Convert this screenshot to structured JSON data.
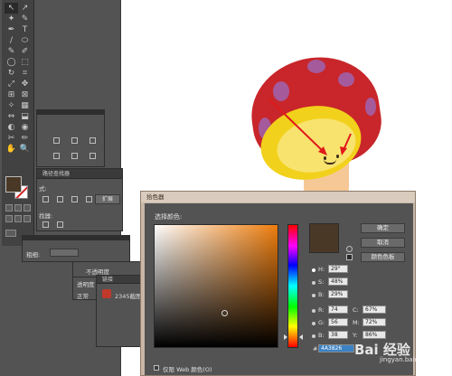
{
  "toolbar": {
    "tools": [
      "↖",
      "↗",
      "✦",
      "✎",
      "✒",
      "T",
      "/",
      "⬭",
      "✎",
      "✐",
      "◯",
      "⬚",
      "↻",
      "⌗",
      "⤢",
      "✥",
      "⊞",
      "⊠",
      "✧",
      "▦",
      "⇔",
      "⬓",
      "◐",
      "◉",
      "✂",
      "✏",
      "✋",
      "🔍"
    ]
  },
  "colors": {
    "fill": "#4a3826",
    "stroke": "#ffffff",
    "cap": "#c8262a",
    "spots": "#a55a9c",
    "gills": "#f2d11c",
    "stem": "#f6c896"
  },
  "panels": {
    "pathfinder_title": "路径查找器",
    "pathfinder_label": "式:",
    "pathfinder_expand": "扩展",
    "pathfinder_finder": "找器:",
    "stroke_weight_label": "粗细:",
    "transparency_title": "不透明度",
    "transparency_tab": "透明度",
    "blend_mode": "正常",
    "links_title": "链接",
    "link_item": "2345截图"
  },
  "dialog": {
    "title": "拾色器",
    "select_color_label": "选择颜色:",
    "buttons": [
      "确定",
      "取消",
      "颜色色板"
    ],
    "hsb": [
      {
        "label": "H:",
        "value": "29°"
      },
      {
        "label": "S:",
        "value": "48%"
      },
      {
        "label": "B:",
        "value": "29%"
      }
    ],
    "rgb": [
      {
        "label": "R:",
        "value": "74"
      },
      {
        "label": "G:",
        "value": "56"
      },
      {
        "label": "B:",
        "value": "38"
      }
    ],
    "cmyk": [
      {
        "label": "C:",
        "value": "67%"
      },
      {
        "label": "M:",
        "value": "72%"
      },
      {
        "label": "Y:",
        "value": "86%"
      }
    ],
    "hex_label": "#",
    "hex_value": "4A3826",
    "websafe_label": "仅限 Web 颜色(O)"
  },
  "watermark": {
    "text": "Bai 经验",
    "sub": "jingyan.baidu.com"
  }
}
